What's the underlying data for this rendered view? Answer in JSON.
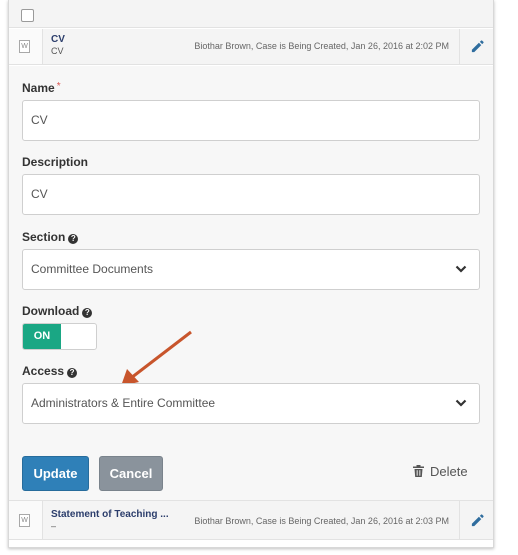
{
  "colors": {
    "accent_toggle": "#1aa784",
    "update_button": "#2f80b8",
    "cancel_button": "#8a939c",
    "annotation_arrow": "#c8552c",
    "doc_title": "#2b3d6b"
  },
  "documents": [
    {
      "title": "CV",
      "subtitle": "CV",
      "meta": "Biothar Brown, Case is Being Created, Jan 26, 2016 at 2:02 PM",
      "icon": "word-document-icon"
    },
    {
      "title": "Statement of Teaching ...",
      "subtitle": "–",
      "meta": "Biothar Brown, Case is Being Created, Jan 26, 2016 at 2:03 PM",
      "icon": "word-document-icon"
    }
  ],
  "doc_icon_letter": "W",
  "form": {
    "name_label": "Name",
    "required_marker": "*",
    "name_value": "CV",
    "description_label": "Description",
    "description_value": "CV",
    "section_label": "Section",
    "section_value": "Committee Documents",
    "download_label": "Download",
    "download_toggle": "ON",
    "access_label": "Access",
    "access_value": "Administrators & Entire Committee",
    "help_glyph": "?"
  },
  "actions": {
    "update_label": "Update",
    "cancel_label": "Cancel",
    "delete_label": "Delete"
  }
}
